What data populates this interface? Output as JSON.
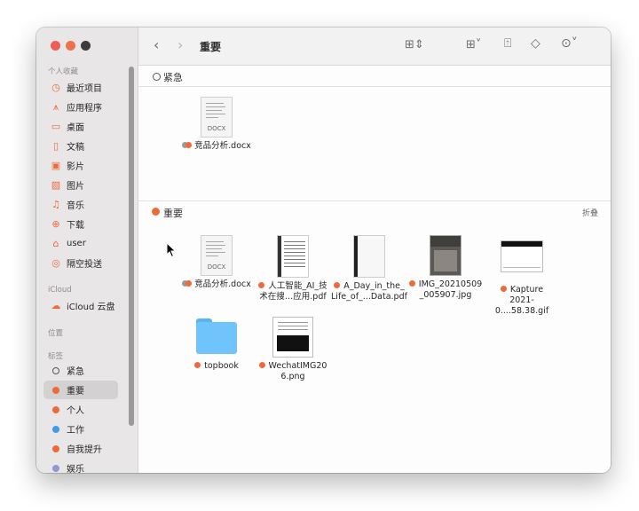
{
  "window": {
    "title": "重要"
  },
  "sidebar": {
    "favorites_header": "个人收藏",
    "favorites": [
      {
        "label": "最近项目",
        "icon": "clock-icon"
      },
      {
        "label": "应用程序",
        "icon": "applications-icon"
      },
      {
        "label": "桌面",
        "icon": "desktop-icon"
      },
      {
        "label": "文稿",
        "icon": "document-icon"
      },
      {
        "label": "影片",
        "icon": "film-icon"
      },
      {
        "label": "图片",
        "icon": "photo-icon"
      },
      {
        "label": "音乐",
        "icon": "music-icon"
      },
      {
        "label": "下载",
        "icon": "download-icon"
      },
      {
        "label": "user",
        "icon": "home-icon"
      },
      {
        "label": "隔空投送",
        "icon": "airdrop-icon"
      }
    ],
    "icloud_header": "iCloud",
    "icloud": [
      {
        "label": "iCloud 云盘",
        "icon": "cloud-icon"
      }
    ],
    "locations_header": "位置",
    "tags_header": "标签",
    "tags": [
      {
        "label": "紧急",
        "color": "none"
      },
      {
        "label": "重要",
        "color": "#ef6a3a",
        "selected": true
      },
      {
        "label": "个人",
        "color": "#ef6a3a"
      },
      {
        "label": "工作",
        "color": "#3d9be9"
      },
      {
        "label": "自我提升",
        "color": "#ef6a3a"
      },
      {
        "label": "娱乐",
        "color": "#8e9ad3"
      }
    ]
  },
  "toolbar": {
    "title": "重要",
    "back_icon": "chevron-left-icon",
    "forward_icon": "chevron-right-icon",
    "view_icon": "icon-grid-icon",
    "group_icon": "group-by-icon",
    "share_icon": "share-icon",
    "tag_icon": "tag-icon",
    "action_icon": "ellipsis-circle-icon",
    "search_icon": "search-icon"
  },
  "groups": [
    {
      "name": "紧急",
      "files": [
        {
          "name": "竞品分析.docx",
          "name2": "",
          "type": "docx",
          "tags": "multi"
        }
      ]
    },
    {
      "name": "重要",
      "collapse_label": "折叠",
      "files": [
        {
          "name": "竞品分析.docx",
          "name2": "",
          "type": "docx",
          "tags": "multi"
        },
        {
          "name": "人工智能_AI_技",
          "name2": "术在搜…应用.pdf",
          "type": "pdf1",
          "tags": "orange"
        },
        {
          "name": "A_Day_in_the_",
          "name2": "Life_of_...Data.pdf",
          "type": "pdf2",
          "tags": "orange"
        },
        {
          "name": "IMG_20210509",
          "name2": "_005907.jpg",
          "type": "jpg",
          "tags": "orange"
        },
        {
          "name": "Kapture",
          "name2": "2021-0....58.38.gif",
          "type": "gif",
          "tags": "orange"
        },
        {
          "name": "topbook",
          "name2": "",
          "type": "folder",
          "tags": "orange"
        },
        {
          "name": "WechatIMG20",
          "name2": "6.png",
          "type": "png",
          "tags": "orange"
        }
      ]
    }
  ],
  "thumbnail_labels": {
    "docx": "DOCX"
  }
}
